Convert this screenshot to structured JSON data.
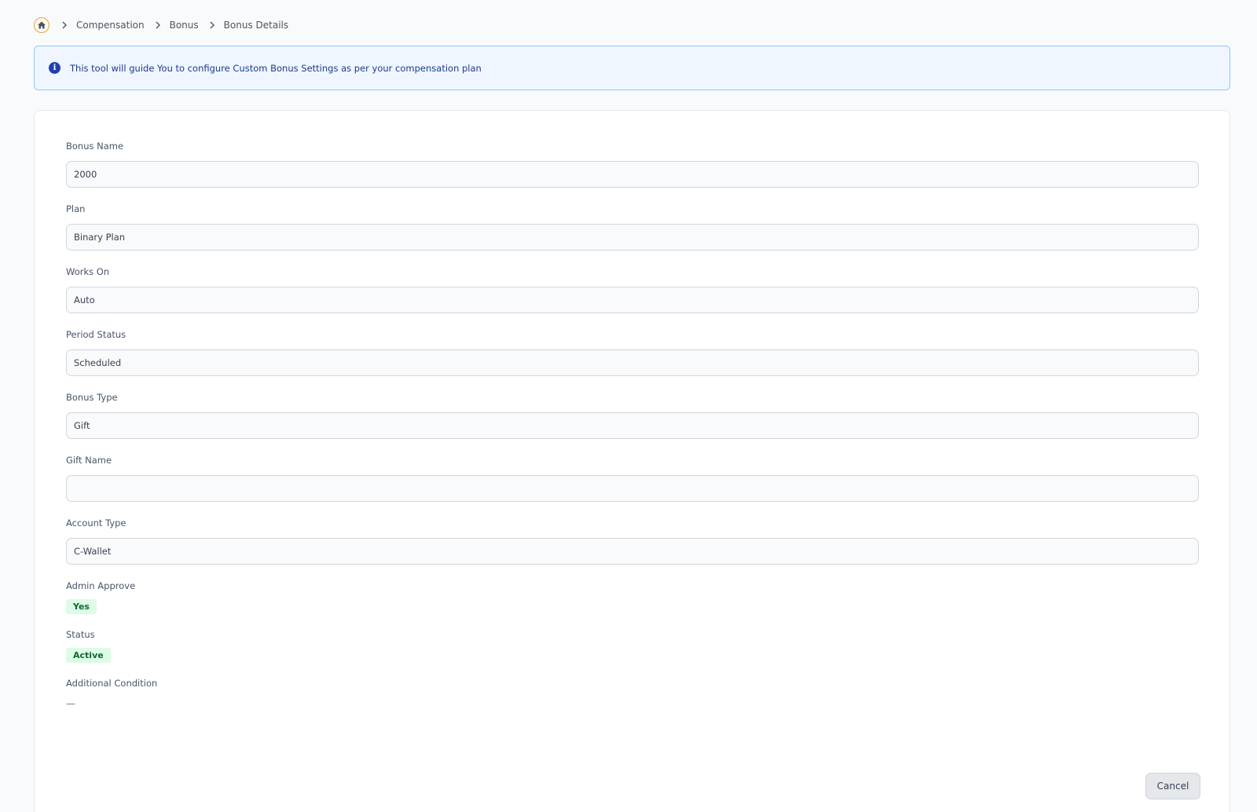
{
  "breadcrumb": {
    "items": [
      "Compensation",
      "Bonus",
      "Bonus Details"
    ]
  },
  "info_banner": {
    "text": "This tool will guide You to configure Custom Bonus Settings as per your compensation plan"
  },
  "form": {
    "bonus_name": {
      "label": "Bonus Name",
      "value": "2000"
    },
    "plan": {
      "label": "Plan",
      "value": "Binary Plan"
    },
    "works_on": {
      "label": "Works On",
      "value": "Auto"
    },
    "period_status": {
      "label": "Period Status",
      "value": "Scheduled"
    },
    "bonus_type": {
      "label": "Bonus Type",
      "value": "Gift"
    },
    "gift_name": {
      "label": "Gift Name",
      "value": ""
    },
    "account_type": {
      "label": "Account Type",
      "value": "C-Wallet"
    },
    "admin_approve": {
      "label": "Admin Approve",
      "value": "Yes"
    },
    "status": {
      "label": "Status",
      "value": "Active"
    },
    "additional_condition": {
      "label": "Additional Condition",
      "value": "—"
    }
  },
  "actions": {
    "cancel_label": "Cancel"
  },
  "colors": {
    "accent_blue": "#1e40af",
    "badge_green_bg": "#dcfce7",
    "badge_green_text": "#166534",
    "home_ring": "#e0a94a"
  }
}
